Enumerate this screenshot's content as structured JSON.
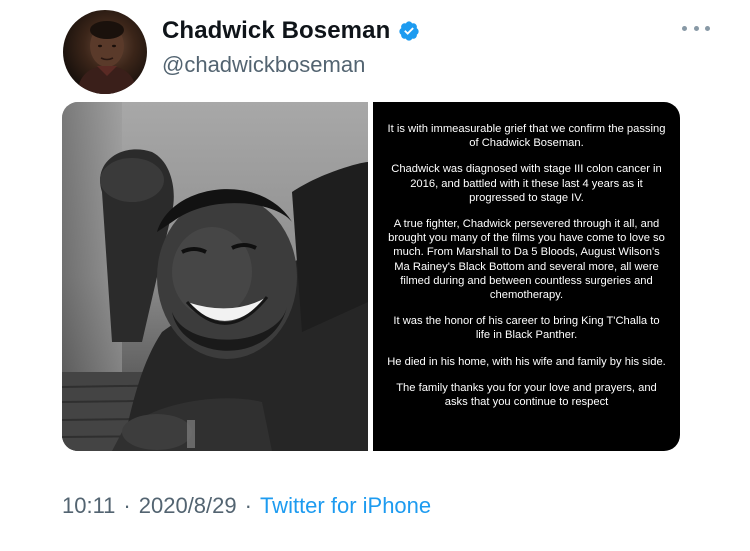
{
  "user": {
    "display_name": "Chadwick Boseman",
    "handle": "@chadwickboseman",
    "verified": true,
    "avatar_icon": "profile-photo",
    "verified_color": "#1d9bf0"
  },
  "actions": {
    "more_icon": "more-horizontal-icon"
  },
  "media": {
    "photo_description_icon": "portrait-photo",
    "statement_paragraphs": [
      "It is with immeasurable grief that we confirm the passing of Chadwick Boseman.",
      "Chadwick was diagnosed with stage III colon cancer in 2016, and battled with it these last 4 years as it progressed to stage IV.",
      "A true fighter, Chadwick persevered through it all, and brought you many of the films you have come to love so much. From Marshall to Da 5 Bloods, August Wilson's Ma Rainey's Black Bottom and several more, all were filmed during and between countless surgeries and chemotherapy.",
      "It was the honor of his career to bring King T'Challa to life in Black Panther.",
      "He died in his home, with his wife and family by his side.",
      "The family thanks you for your love and prayers, and asks that you continue to respect"
    ]
  },
  "meta": {
    "time": "10:11",
    "separator": "·",
    "date": "2020/8/29",
    "source": "Twitter for iPhone",
    "source_color": "#1d9bf0"
  }
}
